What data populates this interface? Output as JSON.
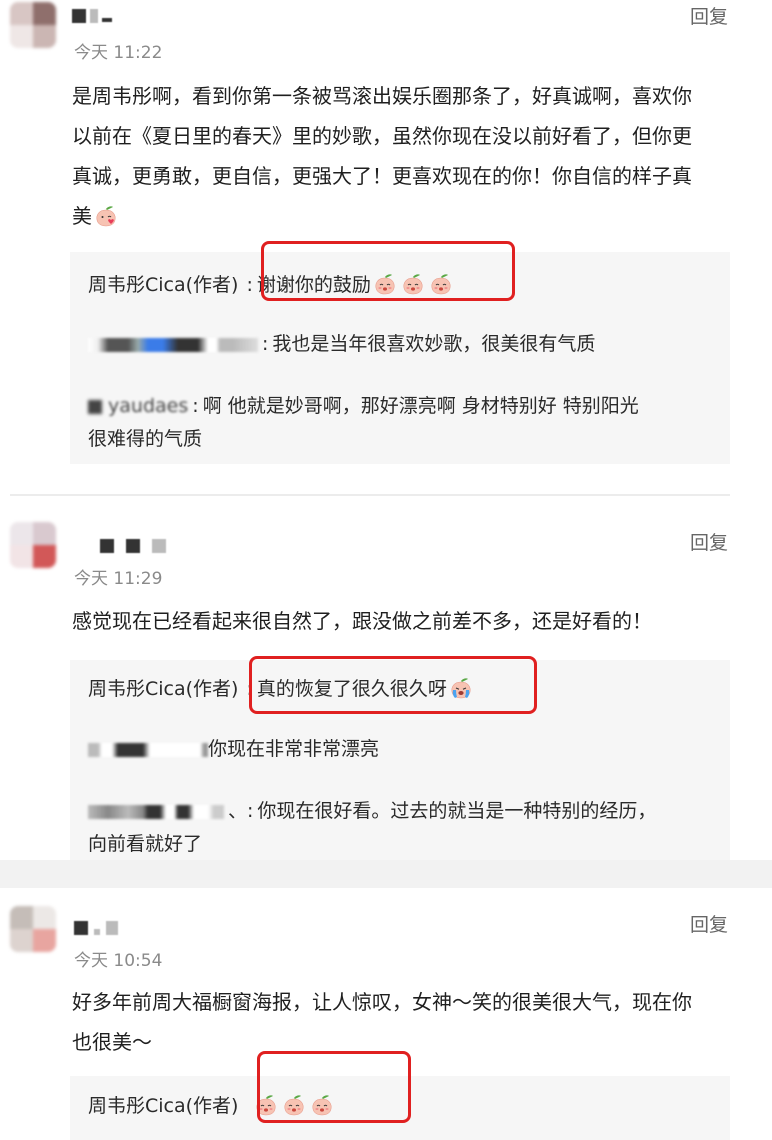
{
  "reply_label": "回复",
  "comments": [
    {
      "time": "今天 11:22",
      "text_lines": [
        "是周韦彤啊，看到你第一条被骂滚出娱乐圈那条了，好真诚啊，喜欢你",
        "以前在《夏日里的春天》里的妙歌，虽然你现在没以前好看了，但你更",
        "真诚，更勇敢，更自信，更强大了！更喜欢现在的你！你自信的样子真",
        "美"
      ],
      "replies": [
        {
          "author": "周韦彤Cica(作者)",
          "sep": ":",
          "text": "谢谢你的鼓励"
        },
        {
          "sep": ":",
          "text": "我也是当年很喜欢妙歌，很美很有气质"
        },
        {
          "name_fragment": "yaudaes",
          "sep": ":",
          "text": "啊 他就是妙哥啊，那好漂亮啊 身材特别好 特别阳光",
          "text2": "很难得的气质"
        }
      ]
    },
    {
      "time": "今天 11:29",
      "text_lines": [
        "感觉现在已经看起来很自然了，跟没做之前差不多，还是好看的！"
      ],
      "replies": [
        {
          "author": "周韦彤Cica(作者)",
          "sep": ":",
          "text": "真的恢复了很久很久呀"
        },
        {
          "text": "你现在非常非常漂亮"
        },
        {
          "sep": "、:",
          "text": "你现在很好看。过去的就当是一种特别的经历，",
          "text2": "向前看就好了"
        }
      ]
    },
    {
      "time": "今天 10:54",
      "text_lines": [
        "好多年前周大福橱窗海报，让人惊叹，女神～笑的很美很大气，现在你",
        "也很美～"
      ],
      "replies": [
        {
          "author": "周韦彤Cica(作者)"
        }
      ]
    }
  ],
  "icons": {
    "peach_emoji": "peach-face-emoji",
    "cry_emoji": "crying-face-emoji"
  },
  "colors": {
    "highlight": "#e02020",
    "subbox": "#f6f6f6",
    "meta": "#8a8a8a"
  }
}
